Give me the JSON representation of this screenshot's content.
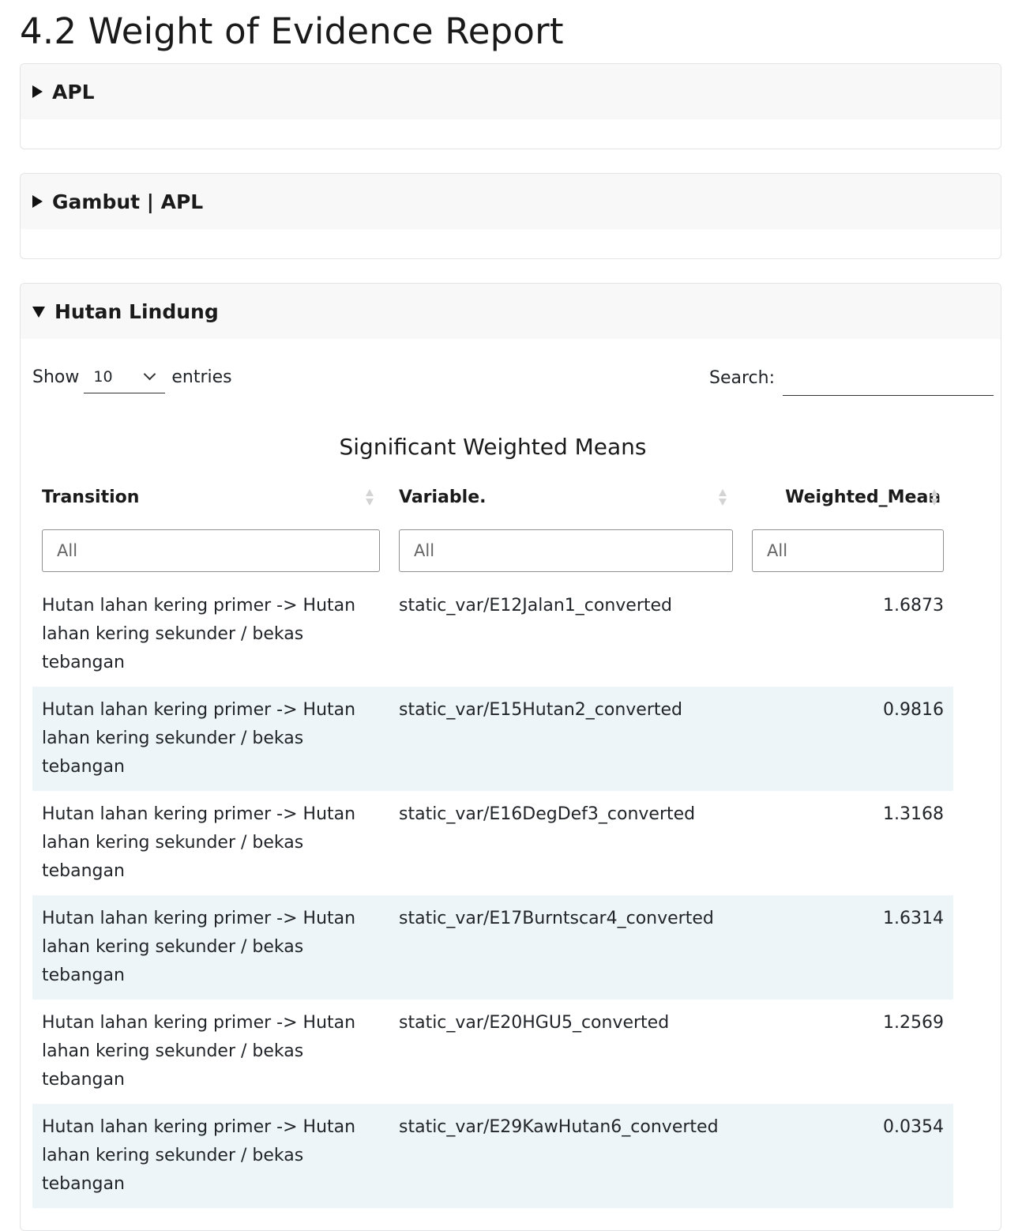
{
  "page": {
    "title": "4.2 Weight of Evidence Report"
  },
  "panels": {
    "apl": {
      "label": "APL",
      "expanded": false
    },
    "gambut": {
      "label": "Gambut | APL",
      "expanded": false
    },
    "hutan": {
      "label": "Hutan Lindung",
      "expanded": true
    }
  },
  "datatable": {
    "show_label": "Show",
    "entries_value": "10",
    "entries_label": "entries",
    "search_label": "Search:",
    "search_value": "",
    "caption": "Significant Weighted Means",
    "columns": [
      "Transition",
      "Variable.",
      "Weighted_Mean"
    ],
    "filter_placeholder": "All",
    "rows": [
      {
        "transition": "Hutan lahan kering primer -> Hutan lahan kering sekunder / bekas tebangan",
        "variable": "static_var/E12Jalan1_converted",
        "weighted_mean": "1.6873"
      },
      {
        "transition": "Hutan lahan kering primer -> Hutan lahan kering sekunder / bekas tebangan",
        "variable": "static_var/E15Hutan2_converted",
        "weighted_mean": "0.9816"
      },
      {
        "transition": "Hutan lahan kering primer -> Hutan lahan kering sekunder / bekas tebangan",
        "variable": "static_var/E16DegDef3_converted",
        "weighted_mean": "1.3168"
      },
      {
        "transition": "Hutan lahan kering primer -> Hutan lahan kering sekunder / bekas tebangan",
        "variable": "static_var/E17Burntscar4_converted",
        "weighted_mean": "1.6314"
      },
      {
        "transition": "Hutan lahan kering primer -> Hutan lahan kering sekunder / bekas tebangan",
        "variable": "static_var/E20HGU5_converted",
        "weighted_mean": "1.2569"
      },
      {
        "transition": "Hutan lahan kering primer -> Hutan lahan kering sekunder / bekas tebangan",
        "variable": "static_var/E29KawHutan6_converted",
        "weighted_mean": "0.0354"
      }
    ]
  },
  "colors": {
    "panel_header_bg": "#f8f8f9",
    "striped_row_bg": "#eef5f9",
    "border": "#e3e4e6"
  }
}
